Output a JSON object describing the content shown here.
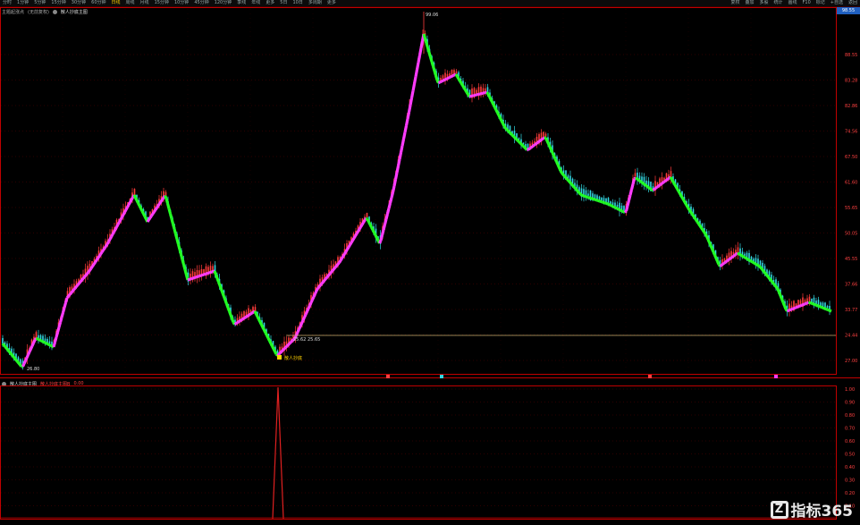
{
  "toolbar": {
    "tabs": [
      "分时",
      "1分钟",
      "5分钟",
      "15分钟",
      "30分钟",
      "60分钟",
      "日线",
      "周线",
      "月线",
      "15分钟",
      "10分钟",
      "45分钟",
      "120分钟",
      "季线",
      "年线",
      "更多",
      "5日",
      "10日",
      "多周期",
      "更多"
    ],
    "active_index": 6,
    "right_items": [
      "复权",
      "叠加",
      "多股",
      "统计",
      "画线",
      "F10",
      "标记",
      "+自选",
      "返回"
    ]
  },
  "main_legend": {
    "title": "主题起涨点",
    "subtitle": "(无前复权)",
    "indicator": "散人抄底主图"
  },
  "sub_legend": {
    "title": "散人抄底主图",
    "value_label": "散人抄底主图B",
    "value": "0.00"
  },
  "price_box": "98.55",
  "annotations": {
    "top_price": "99.06",
    "low_left": "26.80",
    "low_mid_a": "25.62",
    "low_mid_b": "25.65",
    "signal_label": "散人抄底"
  },
  "main_axis": [
    "88.55",
    "83.28",
    "82.86",
    "74.56",
    "67.50",
    "61.60",
    "55.65",
    "50.05",
    "45.55",
    "37.66",
    "33.77",
    "24.44",
    "27.00"
  ],
  "sub_axis": [
    "1.00",
    "0.90",
    "0.80",
    "0.70",
    "0.60",
    "0.50",
    "0.40",
    "0.30",
    "0.20",
    "0.10"
  ],
  "logo_text": "指标365",
  "colors": {
    "up": "#ff3b3b",
    "down": "#33d6e0",
    "magenta": "#ff3cff",
    "green": "#22ff22",
    "grid": "#5a0000",
    "axis": "#c00000"
  }
}
